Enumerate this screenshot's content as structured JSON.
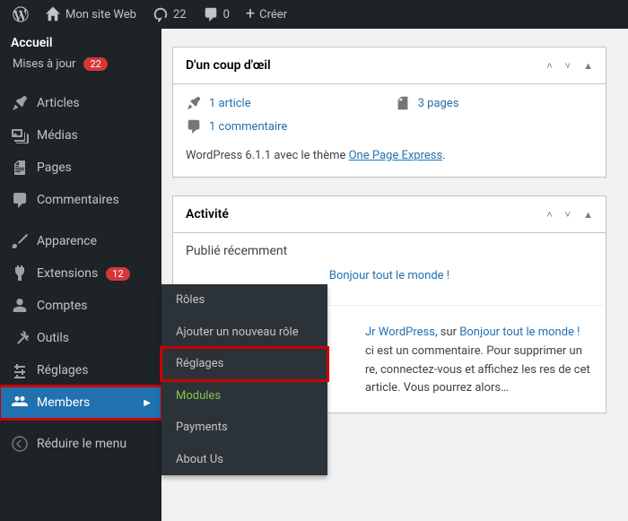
{
  "adminbar": {
    "site_name": "Mon site Web",
    "updates": "22",
    "comments": "0",
    "create": "Créer"
  },
  "sidebar": {
    "home": "Accueil",
    "updates_label": "Mises à jour",
    "updates_badge": "22",
    "items": [
      {
        "label": "Articles"
      },
      {
        "label": "Médias"
      },
      {
        "label": "Pages"
      },
      {
        "label": "Commentaires"
      },
      {
        "label": "Apparence"
      },
      {
        "label": "Extensions",
        "badge": "12"
      },
      {
        "label": "Comptes"
      },
      {
        "label": "Outils"
      },
      {
        "label": "Réglages"
      },
      {
        "label": "Members"
      }
    ],
    "collapse": "Réduire le menu"
  },
  "submenu": {
    "items": [
      "Rôles",
      "Ajouter un nouveau rôle",
      "Réglages",
      "Modules",
      "Payments",
      "About Us"
    ]
  },
  "glance": {
    "title": "D'un coup d'œil",
    "article": "1 article",
    "pages": "3 pages",
    "comment": "1 commentaire",
    "version_prefix": "WordPress 6.1.1 avec le thème ",
    "theme": "One Page Express",
    "version_suffix": "."
  },
  "activity": {
    "title": "Activité",
    "recent_heading": "Publié récemment",
    "recent_post": "Bonjour tout le monde !",
    "comment_link_text_1": "Jr WordPress",
    "comment_mid": ", sur ",
    "comment_link_text_2": "Bonjour tout le monde !",
    "comment_body": "ci est un commentaire. Pour supprimer un re, connectez-vous et affichez les res de cet article. Vous pourrez alors…"
  }
}
